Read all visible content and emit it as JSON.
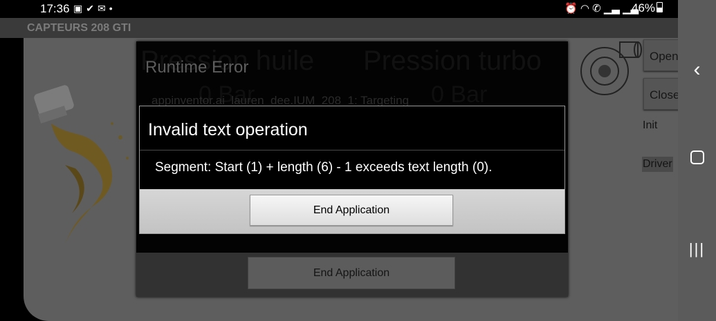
{
  "status_bar": {
    "time": "17:36",
    "left_icons": [
      "gallery-icon",
      "check-icon",
      "mail-icon",
      "dot-icon"
    ],
    "right_icons": [
      "alarm-icon",
      "wifi-icon",
      "wifi-calling-icon",
      "signal-icon",
      "signal-icon"
    ],
    "battery": "46%"
  },
  "app": {
    "title": "CAPTEURS 208 GTI",
    "background_labels": {
      "oil_pressure_title": "Pression huile",
      "turbo_pressure_title": "Pression turbo",
      "oil_value": "0 Bar",
      "turbo_value": "0 Bar"
    },
    "buttons": {
      "open": "Open",
      "close": "Close"
    },
    "labels": {
      "init": "Init",
      "driver": "Driver"
    }
  },
  "back_dialog": {
    "title": "Runtime Error",
    "message": "appinventor.ai_lauren_dee.IUM_208_1: Targeting",
    "button": "End Application"
  },
  "front_dialog": {
    "title": "Invalid text operation",
    "message": "Segment: Start (1) + length (6) - 1 exceeds text length (0).",
    "button": "End Application"
  },
  "nav_bar": {
    "icons": [
      "back-icon",
      "home-icon",
      "recents-icon"
    ]
  },
  "colors": {
    "dialog_background": "#000000",
    "dim_overlay": "#5e5e5e",
    "button_light": "#eeeeee"
  }
}
